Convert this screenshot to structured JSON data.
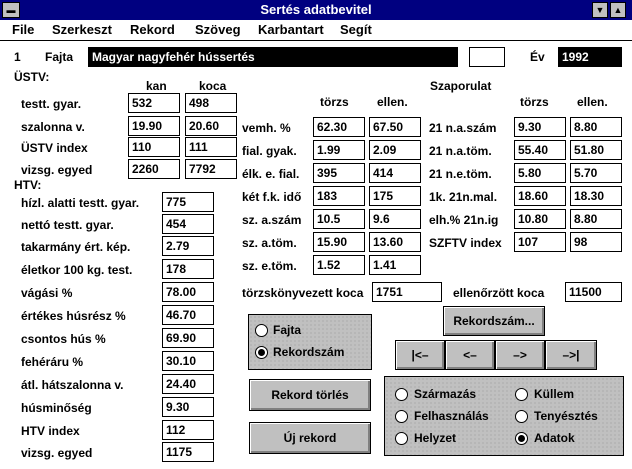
{
  "window": {
    "title": "Sertés adatbevitel"
  },
  "menu": [
    "File",
    "Szerkeszt",
    "Rekord",
    "Szöveg",
    "Karbantart",
    "Segít"
  ],
  "record": {
    "number": "1",
    "fajta_label": "Fajta",
    "fajta_value": "Magyar nagyfehér hússertés",
    "ev_label": "Év",
    "ev_value": "1992",
    "blank": ""
  },
  "ustv": {
    "heading": "ÜSTV:",
    "col_kan": "kan",
    "col_koca": "koca",
    "rows": [
      {
        "label": "testt. gyar.",
        "kan": "532",
        "koca": "498"
      },
      {
        "label": "szalonna v.",
        "kan": "19.90",
        "koca": "20.60"
      },
      {
        "label": "ÜSTV index",
        "kan": "110",
        "koca": "111"
      },
      {
        "label": "vizsg. egyed",
        "kan": "2260",
        "koca": "7792"
      }
    ]
  },
  "htv": {
    "heading": "HTV:",
    "rows": [
      {
        "label": "hízl. alatti testt. gyar.",
        "value": "775"
      },
      {
        "label": "nettó testt. gyar.",
        "value": "454"
      },
      {
        "label": "takarmány ért. kép.",
        "value": "2.79"
      },
      {
        "label": "életkor 100 kg. test.",
        "value": "178"
      },
      {
        "label": "vágási %",
        "value": "78.00"
      },
      {
        "label": "értékes húsrész %",
        "value": "46.70"
      },
      {
        "label": "csontos hús %",
        "value": "69.90"
      },
      {
        "label": "fehéráru %",
        "value": "30.10"
      },
      {
        "label": "átl. hátszalonna v.",
        "value": "24.40"
      },
      {
        "label": "húsminőség",
        "value": "9.30"
      },
      {
        "label": "HTV index",
        "value": "112"
      },
      {
        "label": "vizsg. egyed",
        "value": "1175"
      }
    ]
  },
  "mid": {
    "col_torzs": "törzs",
    "col_ellen": "ellen.",
    "rows": [
      {
        "label": "vemh. %",
        "torzs": "62.30",
        "ellen": "67.50"
      },
      {
        "label": "fial. gyak.",
        "torzs": "1.99",
        "ellen": "2.09"
      },
      {
        "label": "élk. e. fial.",
        "torzs": "395",
        "ellen": "414"
      },
      {
        "label": "két f.k. idő",
        "torzs": "183",
        "ellen": "175"
      },
      {
        "label": "sz. a.szám",
        "torzs": "10.5",
        "ellen": "9.6"
      },
      {
        "label": "sz. a.töm.",
        "torzs": "15.90",
        "ellen": "13.60"
      },
      {
        "label": "sz. e.töm.",
        "torzs": "1.52",
        "ellen": "1.41"
      }
    ]
  },
  "szap": {
    "heading": "Szaporulat",
    "col_torzs": "törzs",
    "col_ellen": "ellen.",
    "rows": [
      {
        "label": "21 n.a.szám",
        "torzs": "9.30",
        "ellen": "8.80"
      },
      {
        "label": "21 n.a.töm.",
        "torzs": "55.40",
        "ellen": "51.80"
      },
      {
        "label": "21 n.e.töm.",
        "torzs": "5.80",
        "ellen": "5.70"
      },
      {
        "label": "1k. 21n.mal.",
        "torzs": "18.60",
        "ellen": "18.30"
      },
      {
        "label": "elh.% 21n.ig",
        "torzs": "10.80",
        "ellen": "8.80"
      },
      {
        "label": "SZFTV index",
        "torzs": "107",
        "ellen": "98"
      }
    ]
  },
  "totals": {
    "torzs_label": "törzskönyvezett koca",
    "torzs_value": "1751",
    "ellen_label": "ellenőrzött koca",
    "ellen_value": "11500"
  },
  "sort": {
    "opt1": "Fajta",
    "opt2": "Rekordszám",
    "selected": "Rekordszám"
  },
  "buttons": {
    "rekordszam": "Rekordszám...",
    "torles": "Rekord törlés",
    "uj": "Új rekord",
    "first": "|<–",
    "prev": "<–",
    "next": "–>",
    "last": "–>|"
  },
  "view": {
    "opts": [
      "Származás",
      "Küllem",
      "Felhasználás",
      "Tenyésztés",
      "Helyzet",
      "Adatok"
    ],
    "selected": "Adatok"
  }
}
